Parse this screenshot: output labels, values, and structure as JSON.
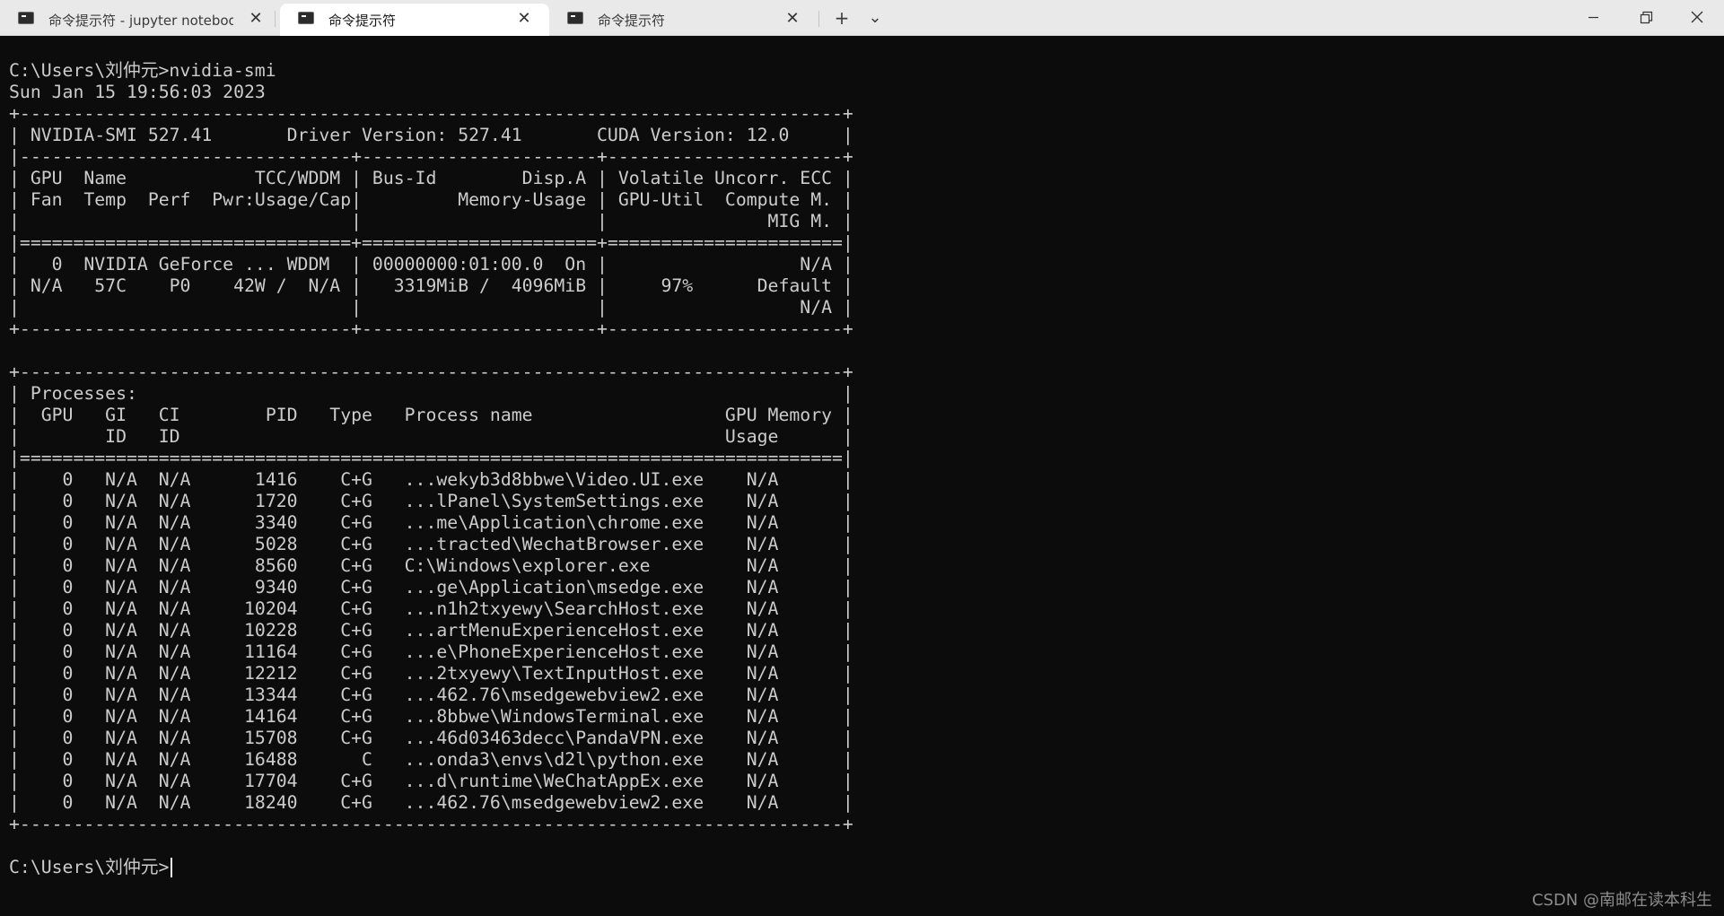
{
  "tabs": [
    {
      "label": "命令提示符 - jupyter notebook",
      "active": false
    },
    {
      "label": "命令提示符",
      "active": true
    },
    {
      "label": "命令提示符",
      "active": false
    }
  ],
  "tabbar": {
    "new_tab_glyph": "+",
    "dropdown_glyph": "⌄",
    "close_glyph": "✕",
    "tab_icon": "terminal-icon"
  },
  "window_controls": {
    "minimize": "minimize-icon",
    "restore": "restore-icon",
    "close": "close-icon"
  },
  "terminal": {
    "lines": [
      "",
      "C:\\Users\\刘仲元>nvidia-smi",
      "Sun Jan 15 19:56:03 2023",
      "+-----------------------------------------------------------------------------+",
      "| NVIDIA-SMI 527.41       Driver Version: 527.41       CUDA Version: 12.0     |",
      "|-------------------------------+----------------------+----------------------+",
      "| GPU  Name            TCC/WDDM | Bus-Id        Disp.A | Volatile Uncorr. ECC |",
      "| Fan  Temp  Perf  Pwr:Usage/Cap|         Memory-Usage | GPU-Util  Compute M. |",
      "|                               |                      |               MIG M. |",
      "|===============================+======================+======================|",
      "|   0  NVIDIA GeForce ... WDDM  | 00000000:01:00.0  On |                  N/A |",
      "| N/A   57C    P0    42W /  N/A |   3319MiB /  4096MiB |     97%      Default |",
      "|                               |                      |                  N/A |",
      "+-------------------------------+----------------------+----------------------+",
      "",
      "+-----------------------------------------------------------------------------+",
      "| Processes:                                                                  |",
      "|  GPU   GI   CI        PID   Type   Process name                  GPU Memory |",
      "|        ID   ID                                                   Usage      |",
      "|=============================================================================|",
      "|    0   N/A  N/A      1416    C+G   ...wekyb3d8bbwe\\Video.UI.exe    N/A      |",
      "|    0   N/A  N/A      1720    C+G   ...lPanel\\SystemSettings.exe    N/A      |",
      "|    0   N/A  N/A      3340    C+G   ...me\\Application\\chrome.exe    N/A      |",
      "|    0   N/A  N/A      5028    C+G   ...tracted\\WechatBrowser.exe    N/A      |",
      "|    0   N/A  N/A      8560    C+G   C:\\Windows\\explorer.exe         N/A      |",
      "|    0   N/A  N/A      9340    C+G   ...ge\\Application\\msedge.exe    N/A      |",
      "|    0   N/A  N/A     10204    C+G   ...n1h2txyewy\\SearchHost.exe    N/A      |",
      "|    0   N/A  N/A     10228    C+G   ...artMenuExperienceHost.exe    N/A      |",
      "|    0   N/A  N/A     11164    C+G   ...e\\PhoneExperienceHost.exe    N/A      |",
      "|    0   N/A  N/A     12212    C+G   ...2txyewy\\TextInputHost.exe    N/A      |",
      "|    0   N/A  N/A     13344    C+G   ...462.76\\msedgewebview2.exe    N/A      |",
      "|    0   N/A  N/A     14164    C+G   ...8bbwe\\WindowsTerminal.exe    N/A      |",
      "|    0   N/A  N/A     15708    C+G   ...46d03463decc\\PandaVPN.exe    N/A      |",
      "|    0   N/A  N/A     16488      C   ...onda3\\envs\\d2l\\python.exe    N/A      |",
      "|    0   N/A  N/A     17704    C+G   ...d\\runtime\\WeChatAppEx.exe    N/A      |",
      "|    0   N/A  N/A     18240    C+G   ...462.76\\msedgewebview2.exe    N/A      |",
      "+-----------------------------------------------------------------------------+",
      "",
      "C:\\Users\\刘仲元>"
    ]
  },
  "watermark": "CSDN @南邮在读本科生",
  "colors": {
    "terminal_bg": "#0c0c0c",
    "terminal_fg": "#cccccc",
    "tabbar_bg": "#e9e9e9",
    "active_tab_bg": "#ffffff"
  }
}
